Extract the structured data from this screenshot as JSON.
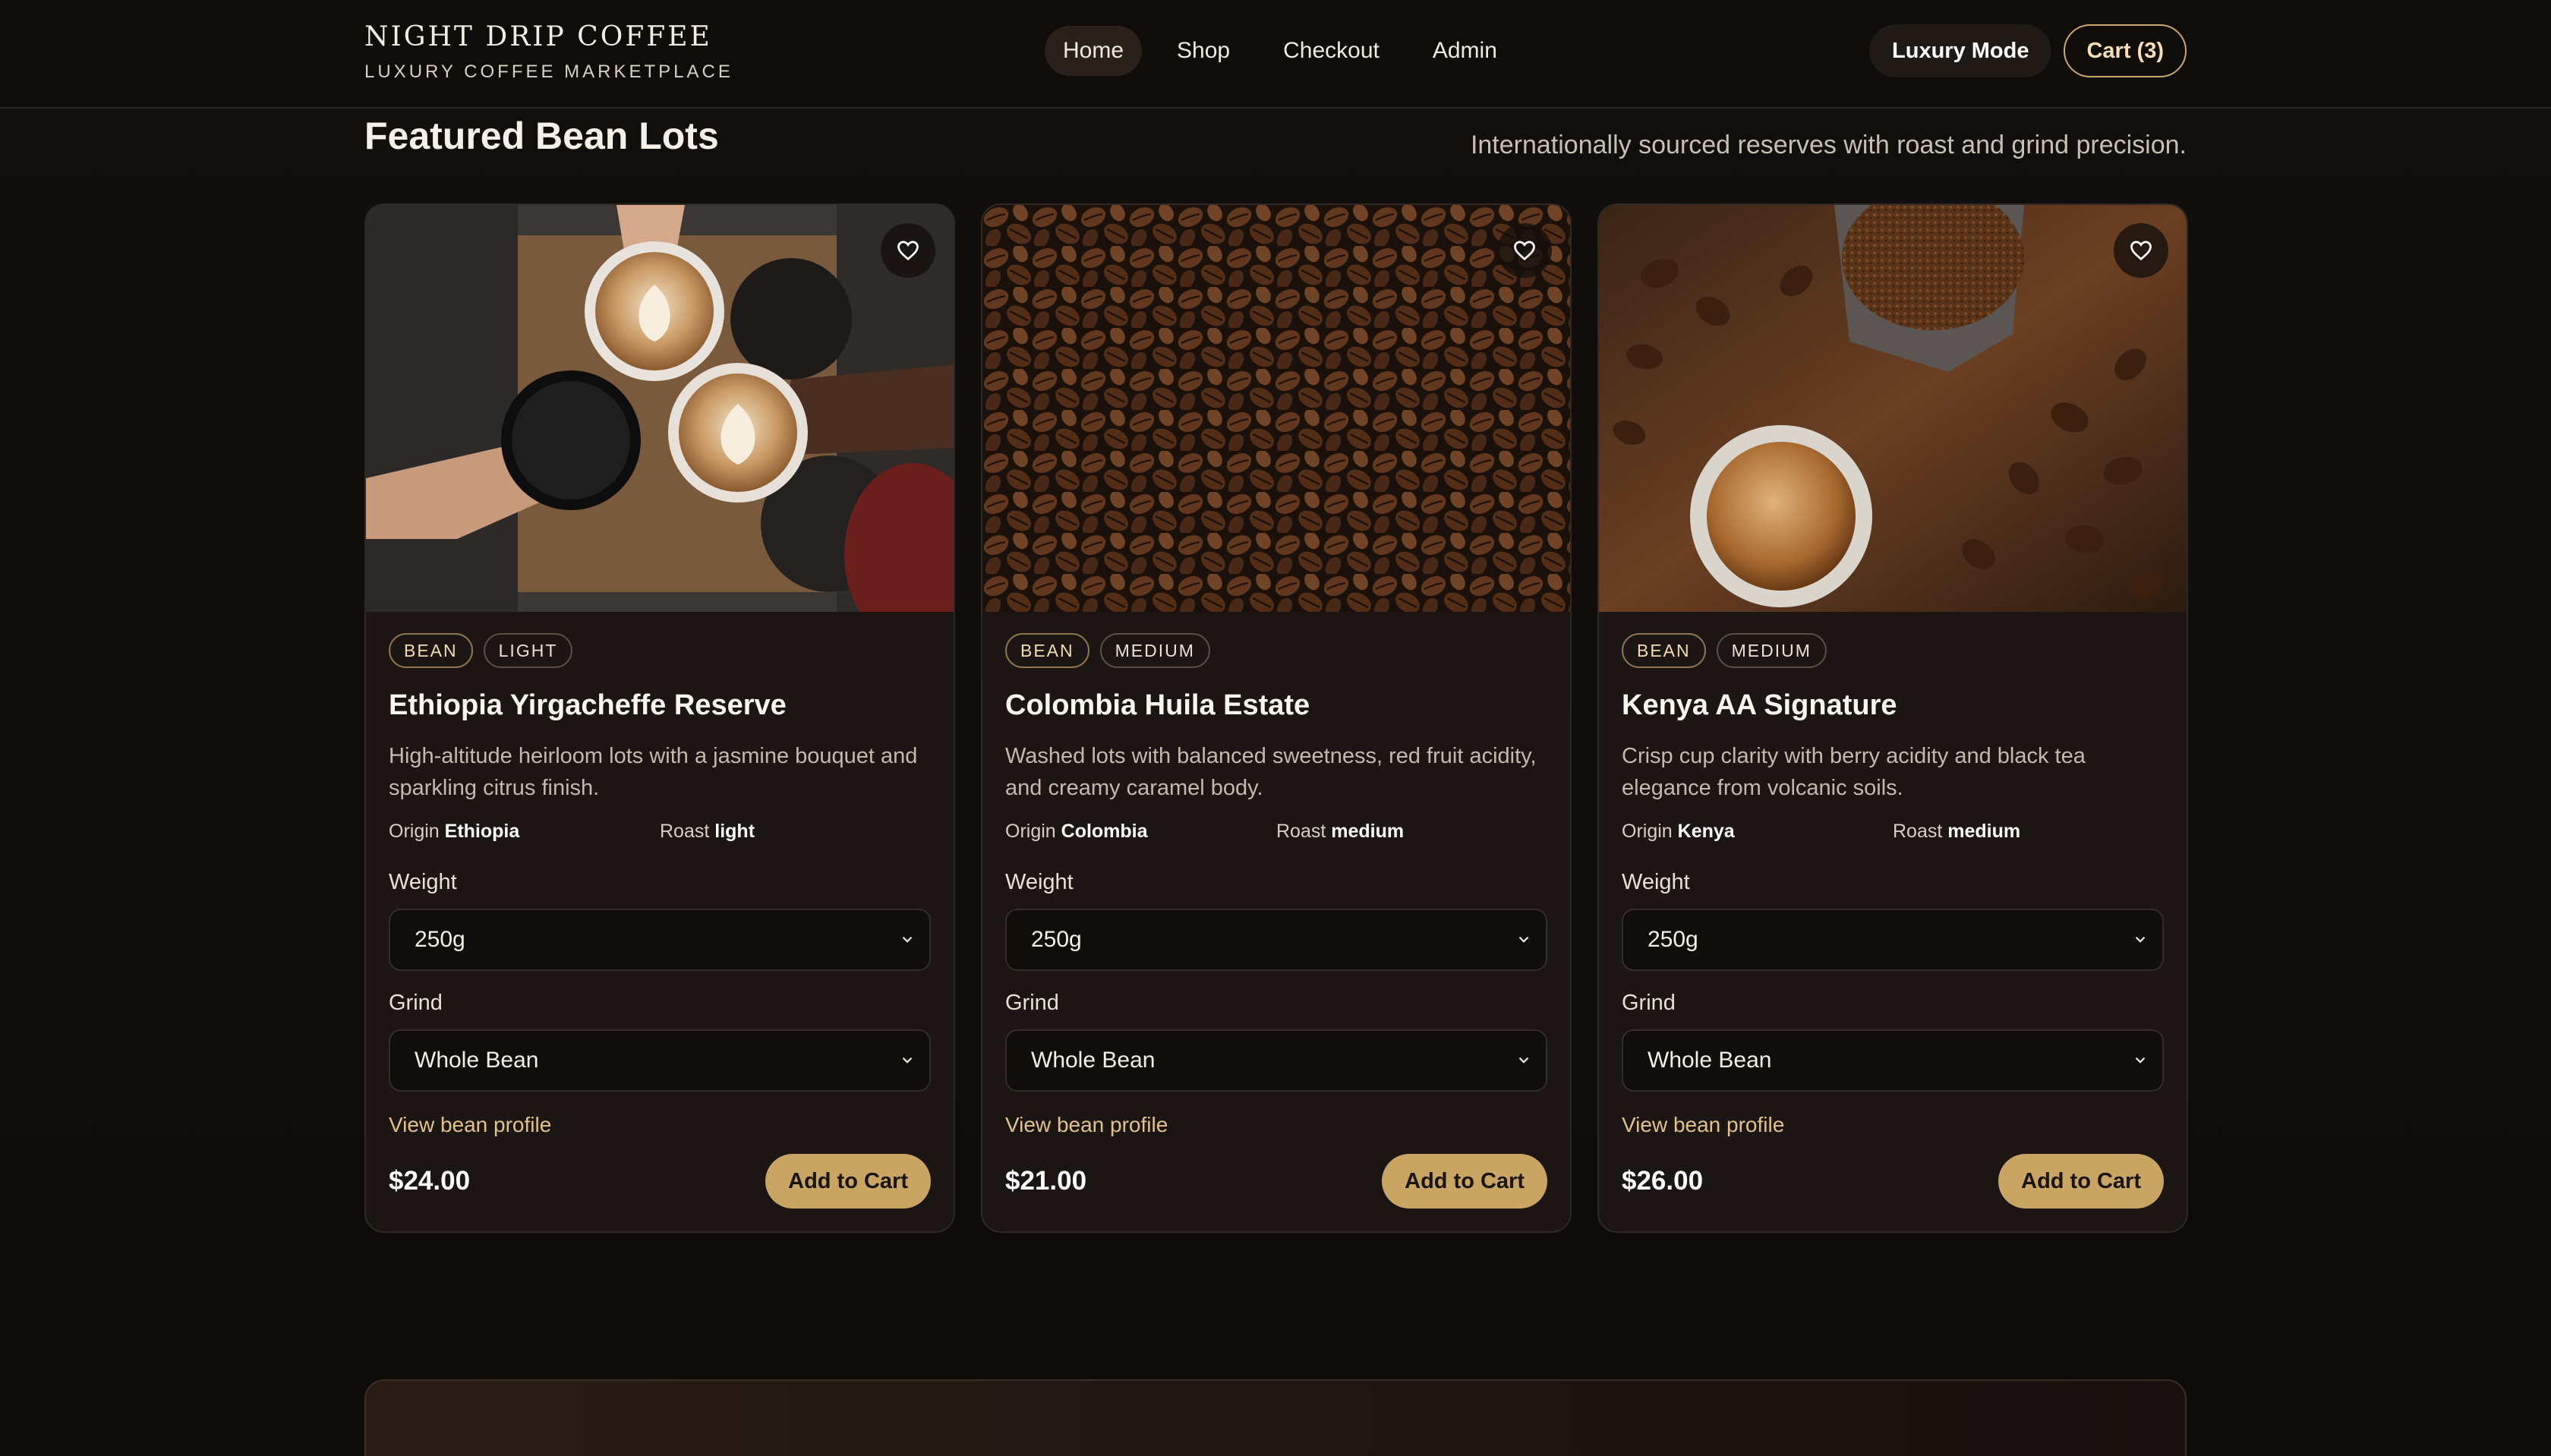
{
  "header": {
    "brand_title": "NIGHT DRIP COFFEE",
    "brand_subtitle": "LUXURY COFFEE MARKETPLACE",
    "nav": [
      {
        "label": "Home",
        "active": true
      },
      {
        "label": "Shop",
        "active": false
      },
      {
        "label": "Checkout",
        "active": false
      },
      {
        "label": "Admin",
        "active": false
      }
    ],
    "mode_button": "Luxury Mode",
    "cart_button": "Cart (3)"
  },
  "section": {
    "title": "Featured Bean Lots",
    "subtitle": "Internationally sourced reserves with roast and grind precision."
  },
  "labels": {
    "origin": "Origin",
    "roast": "Roast",
    "weight": "Weight",
    "grind": "Grind",
    "view_profile": "View bean profile",
    "add_to_cart": "Add to Cart"
  },
  "products": [
    {
      "tags": [
        "BEAN",
        "LIGHT"
      ],
      "name": "Ethiopia Yirgacheffe Reserve",
      "description": "High-altitude heirloom lots with a jasmine bouquet and sparkling citrus finish.",
      "origin": "Ethiopia",
      "roast": "light",
      "weight": "250g",
      "grind": "Whole Bean",
      "price": "$24.00",
      "image": "latte-cheers-photo"
    },
    {
      "tags": [
        "BEAN",
        "MEDIUM"
      ],
      "name": "Colombia Huila Estate",
      "description": "Washed lots with balanced sweetness, red fruit acidity, and creamy caramel body.",
      "origin": "Colombia",
      "roast": "medium",
      "weight": "250g",
      "grind": "Whole Bean",
      "price": "$21.00",
      "image": "roasted-beans-photo"
    },
    {
      "tags": [
        "BEAN",
        "MEDIUM"
      ],
      "name": "Kenya AA Signature",
      "description": "Crisp cup clarity with berry acidity and black tea elegance from volcanic soils.",
      "origin": "Kenya",
      "roast": "medium",
      "weight": "250g",
      "grind": "Whole Bean",
      "price": "$26.00",
      "image": "espresso-and-grounds-photo"
    }
  ],
  "colors": {
    "background": "#0f0c0a",
    "card": "#1b1613",
    "accent_gold": "#c9a564",
    "link_gold": "#e2c387"
  },
  "icons": {
    "favorite": "heart-icon",
    "dropdown": "chevron-down-icon"
  }
}
